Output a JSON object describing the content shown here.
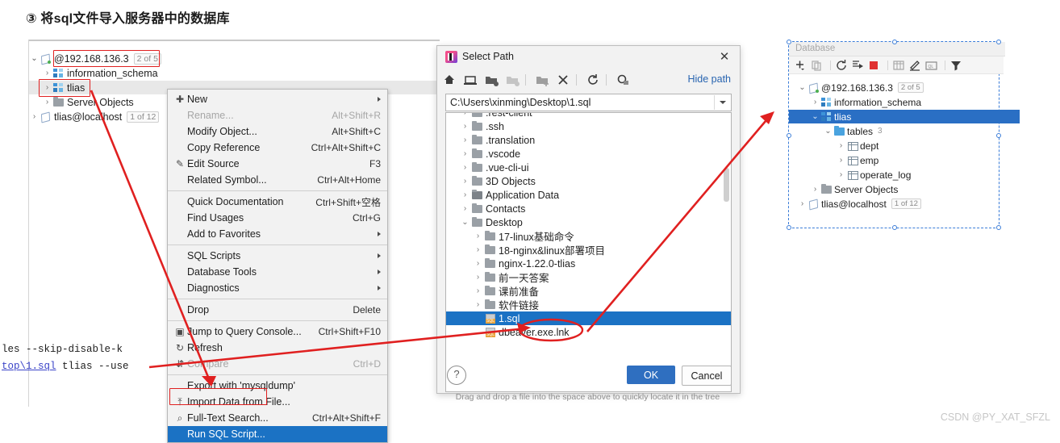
{
  "heading": "③ 将sql文件导入服务器中的数据库",
  "watermark": "CSDN @PY_XAT_SFZL",
  "left_tree": {
    "rows": [
      {
        "label": "@192.168.136.3",
        "badge": "2 of 5"
      },
      {
        "label": "information_schema",
        "badge": ""
      },
      {
        "label": "tlias",
        "badge": ""
      },
      {
        "label": "Server Objects",
        "badge": ""
      },
      {
        "label": "tlias@localhost",
        "badge": "1 of 12"
      }
    ]
  },
  "context_menu": {
    "items": [
      {
        "label": "New",
        "shortcut": "",
        "icon": "plus-icon",
        "submenu": true,
        "disabled": false
      },
      {
        "label": "Rename...",
        "shortcut": "Alt+Shift+R",
        "icon": "",
        "submenu": false,
        "disabled": true
      },
      {
        "label": "Modify Object...",
        "shortcut": "Alt+Shift+C",
        "icon": "",
        "submenu": false,
        "disabled": false
      },
      {
        "label": "Copy Reference",
        "shortcut": "Ctrl+Alt+Shift+C",
        "icon": "",
        "submenu": false,
        "disabled": false
      },
      {
        "label": "Edit Source",
        "shortcut": "F3",
        "icon": "pencil-icon",
        "submenu": false,
        "disabled": false
      },
      {
        "label": "Related Symbol...",
        "shortcut": "Ctrl+Alt+Home",
        "icon": "",
        "submenu": false,
        "disabled": false
      },
      {
        "label": "Quick Documentation",
        "shortcut": "Ctrl+Shift+空格",
        "icon": "",
        "submenu": false,
        "disabled": false
      },
      {
        "label": "Find Usages",
        "shortcut": "Ctrl+G",
        "icon": "",
        "submenu": false,
        "disabled": false
      },
      {
        "label": "Add to Favorites",
        "shortcut": "",
        "icon": "",
        "submenu": true,
        "disabled": false
      },
      {
        "label": "SQL Scripts",
        "shortcut": "",
        "icon": "",
        "submenu": true,
        "disabled": false
      },
      {
        "label": "Database Tools",
        "shortcut": "",
        "icon": "",
        "submenu": true,
        "disabled": false
      },
      {
        "label": "Diagnostics",
        "shortcut": "",
        "icon": "",
        "submenu": true,
        "disabled": false
      },
      {
        "label": "Drop",
        "shortcut": "Delete",
        "icon": "",
        "submenu": false,
        "disabled": false
      },
      {
        "label": "Jump to Query Console...",
        "shortcut": "Ctrl+Shift+F10",
        "icon": "console-icon",
        "submenu": false,
        "disabled": false
      },
      {
        "label": "Refresh",
        "shortcut": "",
        "icon": "refresh-icon",
        "submenu": false,
        "disabled": false
      },
      {
        "label": "Compare",
        "shortcut": "Ctrl+D",
        "icon": "compare-icon",
        "submenu": false,
        "disabled": true
      },
      {
        "label": "Export with 'mysqldump'",
        "shortcut": "",
        "icon": "",
        "submenu": false,
        "disabled": false
      },
      {
        "label": "Import Data from File...",
        "shortcut": "",
        "icon": "import-icon",
        "submenu": false,
        "disabled": false
      },
      {
        "label": "Full-Text Search...",
        "shortcut": "Ctrl+Alt+Shift+F",
        "icon": "search-icon",
        "submenu": false,
        "disabled": false
      },
      {
        "label": "Run SQL Script...",
        "shortcut": "",
        "icon": "",
        "submenu": false,
        "disabled": false,
        "highlighted": true
      }
    ]
  },
  "dialog": {
    "title": "Select Path",
    "close_label": "✕",
    "hide_path_label": "Hide path",
    "path_value": "C:\\Users\\xinming\\Desktop\\1.sql",
    "toolbar_icons": [
      "home-icon",
      "desktop-icon",
      "folder-icon",
      "folder-disabled-icon",
      "new-folder-icon",
      "delete-icon",
      "refresh-icon",
      "show-hidden-icon"
    ],
    "drag_hint": "Drag and drop a file into the space above to quickly locate it in the tree",
    "help_label": "?",
    "ok_label": "OK",
    "cancel_label": "Cancel",
    "file_tree": [
      {
        "label": ".rest-client",
        "indent": 0,
        "type": "folder",
        "state": "collapsed"
      },
      {
        "label": ".ssh",
        "indent": 0,
        "type": "folder",
        "state": "collapsed"
      },
      {
        "label": ".translation",
        "indent": 0,
        "type": "folder",
        "state": "collapsed"
      },
      {
        "label": ".vscode",
        "indent": 0,
        "type": "folder",
        "state": "collapsed"
      },
      {
        "label": ".vue-cli-ui",
        "indent": 0,
        "type": "folder",
        "state": "collapsed"
      },
      {
        "label": "3D Objects",
        "indent": 0,
        "type": "folder",
        "state": "collapsed"
      },
      {
        "label": "Application Data",
        "indent": 0,
        "type": "folder-link",
        "state": "collapsed"
      },
      {
        "label": "Contacts",
        "indent": 0,
        "type": "folder",
        "state": "collapsed"
      },
      {
        "label": "Desktop",
        "indent": 0,
        "type": "folder",
        "state": "expanded"
      },
      {
        "label": "17-linux基础命令",
        "indent": 1,
        "type": "folder",
        "state": "collapsed"
      },
      {
        "label": "18-nginx&linux部署项目",
        "indent": 1,
        "type": "folder",
        "state": "collapsed"
      },
      {
        "label": "nginx-1.22.0-tlias",
        "indent": 1,
        "type": "folder",
        "state": "collapsed"
      },
      {
        "label": "前一天答案",
        "indent": 1,
        "type": "folder",
        "state": "collapsed"
      },
      {
        "label": "课前准备",
        "indent": 1,
        "type": "folder",
        "state": "collapsed"
      },
      {
        "label": "软件链接",
        "indent": 1,
        "type": "folder",
        "state": "collapsed"
      },
      {
        "label": "1.sql",
        "indent": 1,
        "type": "sql",
        "state": "none",
        "selected": true
      },
      {
        "label": "dbeaver.exe.lnk",
        "indent": 1,
        "type": "file",
        "state": "none"
      }
    ]
  },
  "right_panel": {
    "header": "Database",
    "toolbar_icons": [
      "add-icon",
      "copy-icon",
      "refresh-icon",
      "run-icon",
      "stop-icon",
      "table-icon",
      "edit-icon",
      "query-console-icon",
      "filter-icon"
    ],
    "rows": [
      {
        "label": "@192.168.136.3",
        "indent": 0,
        "state": "expanded",
        "type": "connection",
        "badge": "2 of 5",
        "count": "",
        "selected": false
      },
      {
        "label": "information_schema",
        "indent": 1,
        "state": "collapsed",
        "type": "schema",
        "badge": "",
        "count": "",
        "selected": false
      },
      {
        "label": "tlias",
        "indent": 1,
        "state": "expanded",
        "type": "schema",
        "badge": "",
        "count": "",
        "selected": true
      },
      {
        "label": "tables",
        "indent": 2,
        "state": "expanded",
        "type": "folder-blue",
        "badge": "",
        "count": "3",
        "selected": false
      },
      {
        "label": "dept",
        "indent": 3,
        "state": "collapsed",
        "type": "table",
        "badge": "",
        "count": "",
        "selected": false
      },
      {
        "label": "emp",
        "indent": 3,
        "state": "collapsed",
        "type": "table",
        "badge": "",
        "count": "",
        "selected": false
      },
      {
        "label": "operate_log",
        "indent": 3,
        "state": "collapsed",
        "type": "table",
        "badge": "",
        "count": "",
        "selected": false
      },
      {
        "label": "Server Objects",
        "indent": 1,
        "state": "collapsed",
        "type": "folder",
        "badge": "",
        "count": "",
        "selected": false
      },
      {
        "label": "tlias@localhost",
        "indent": 0,
        "state": "collapsed",
        "type": "connection-plain",
        "badge": "1 of 12",
        "count": "",
        "selected": false
      }
    ]
  },
  "terminal": {
    "line1": "les --skip-disable-k",
    "line2_link": "top\\1.sql",
    "line2_rest": " tlias --use"
  },
  "colors": {
    "accent_blue": "#2a6fc4",
    "annotation_red": "#e02020",
    "link_blue": "#2864b0",
    "selection_blue": "#1b72c4"
  }
}
